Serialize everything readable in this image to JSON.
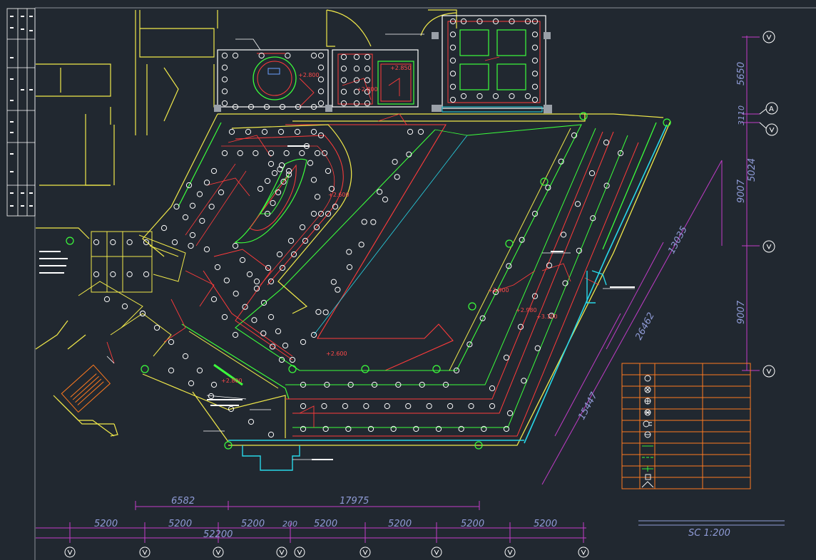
{
  "drawing": {
    "scale_label": "SC 1:200",
    "grid_bubble_label": "A",
    "elevations": [
      "+2.800",
      "+2.850",
      "+2.800",
      "+2.600",
      "+2.600",
      "+2.900",
      "+2.980",
      "+3.100",
      "+2.800"
    ],
    "bottom_dims_top": [
      "6582",
      "17975"
    ],
    "bottom_dims_row": [
      "5200",
      "5200",
      "5200",
      "200",
      "5200",
      "5200",
      "5200",
      "5200"
    ],
    "bottom_total": "52200",
    "right_vertical_dims": [
      "5650",
      "3110",
      "5024",
      "9007",
      "9007"
    ],
    "diagonal_dims": [
      "13035",
      "26462",
      "15447"
    ],
    "legend_rows": 11
  },
  "colors": {
    "background": "#212830",
    "outline": "#ffff66",
    "red": "#ff3b3b",
    "green": "#3cff3c",
    "cyan": "#28d7e8",
    "purple": "#c23cc8",
    "white": "#ffffff",
    "orange": "#ff7a1f",
    "dimension_text": "#8f9bd6"
  }
}
